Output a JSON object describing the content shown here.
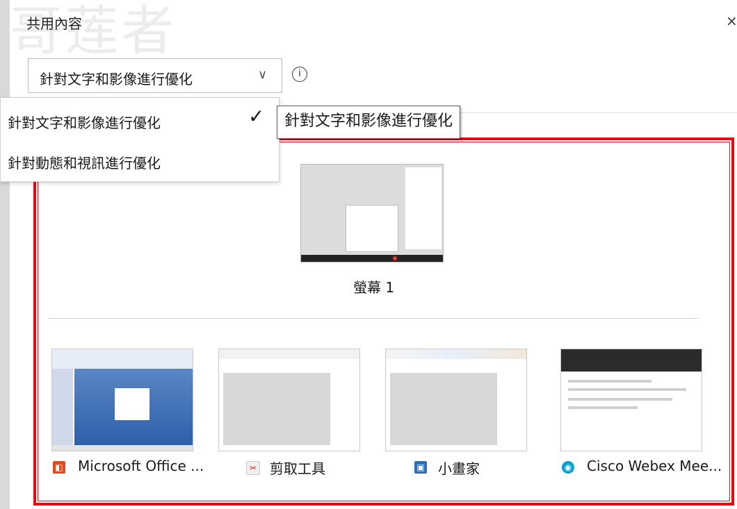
{
  "dialog": {
    "title": "共用內容",
    "close_glyph": "×",
    "watermark": "哥莲者"
  },
  "optimize": {
    "selected": "針對文字和影像進行優化",
    "chevron_glyph": "∨",
    "info_glyph": "i",
    "options": [
      "針對文字和影像進行優化",
      "針對動態和視訊進行優化"
    ],
    "check_glyph": "✓",
    "tooltip": "針對文字和影像進行優化"
  },
  "screens": [
    {
      "label": "螢幕 1"
    }
  ],
  "apps": [
    {
      "name": "Microsoft Office ...",
      "icon": "office-icon"
    },
    {
      "name": "剪取工具",
      "icon": "snipping-tool-icon"
    },
    {
      "name": "小畫家",
      "icon": "paint-icon"
    },
    {
      "name": "Cisco Webex Mee...",
      "icon": "webex-icon"
    }
  ],
  "colors": {
    "highlight_box": "#e60012",
    "background": "#d9d9d9",
    "dialog": "#ffffff"
  }
}
